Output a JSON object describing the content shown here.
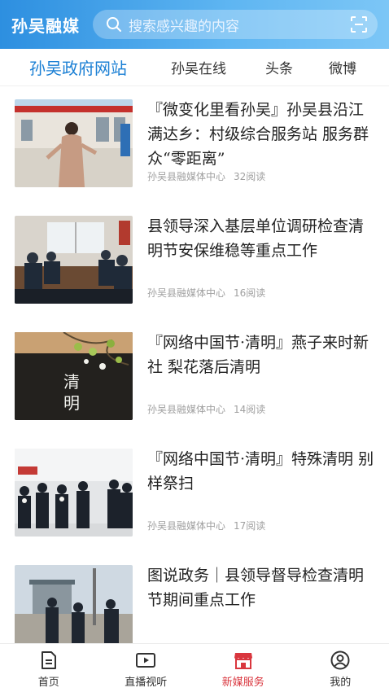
{
  "header": {
    "logo_text": "孙吴融媒",
    "search_placeholder": "搜索感兴趣的内容",
    "accent_color": "#2d8fe0"
  },
  "tabs": [
    {
      "label": "孙吴政府网站",
      "active": true
    },
    {
      "label": "孙吴在线",
      "active": false
    },
    {
      "label": "头条",
      "active": false
    },
    {
      "label": "微博",
      "active": false
    }
  ],
  "articles": [
    {
      "title": "『微变化里看孙吴』孙吴县沿江满达乡：村级综合服务站 服务群众“零距离”",
      "source": "孙吴县融媒体中心",
      "reads": "32阅读"
    },
    {
      "title": "县领导深入基层单位调研检查清明节安保维稳等重点工作",
      "source": "孙吴县融媒体中心",
      "reads": "16阅读"
    },
    {
      "title": "『网络中国节·清明』燕子来时新社 梨花落后清明",
      "source": "孙吴县融媒体中心",
      "reads": "14阅读",
      "thumb_caption": "清明"
    },
    {
      "title": "『网络中国节·清明』特殊清明 别样祭扫",
      "source": "孙吴县融媒体中心",
      "reads": "17阅读"
    },
    {
      "title": "图说政务｜县领导督导检查清明节期间重点工作",
      "source": "",
      "reads": ""
    }
  ],
  "bottom_nav": [
    {
      "label": "首页",
      "icon": "home-doc-icon",
      "active": false
    },
    {
      "label": "直播视听",
      "icon": "video-play-icon",
      "active": false
    },
    {
      "label": "新媒服务",
      "icon": "store-icon",
      "active": true
    },
    {
      "label": "我的",
      "icon": "user-icon",
      "active": false
    }
  ],
  "colors": {
    "active_nav": "#d9363e",
    "active_tab": "#1a7fd4",
    "meta_text": "#a0a0a0"
  }
}
